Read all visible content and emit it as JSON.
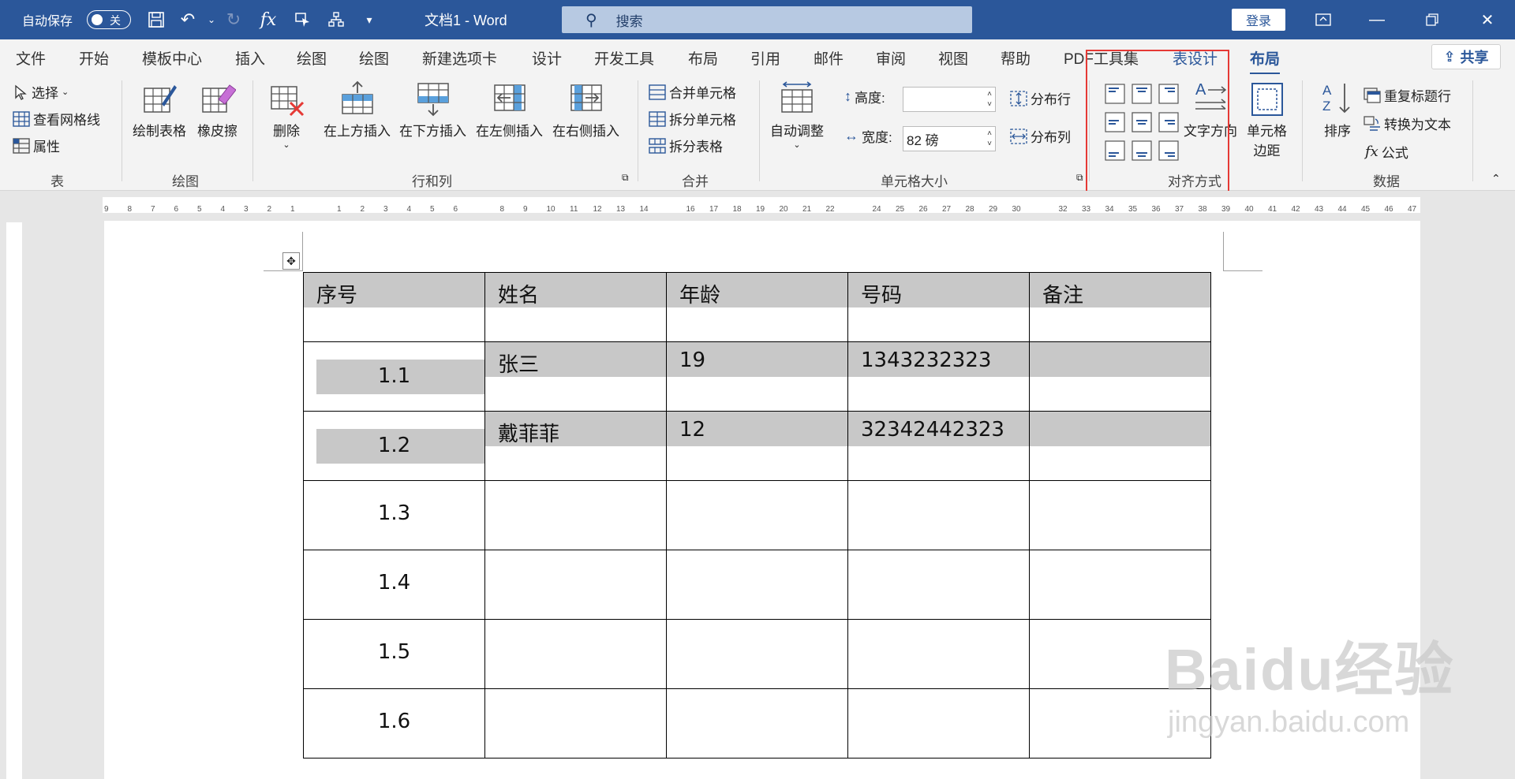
{
  "titlebar": {
    "autosave_label": "自动保存",
    "autosave_state": "关",
    "doc_title": "文档1  -  Word",
    "search_placeholder": "搜索",
    "login": "登录"
  },
  "tabs": [
    "文件",
    "开始",
    "模板中心",
    "插入",
    "绘图",
    "绘图",
    "新建选项卡",
    "设计",
    "开发工具",
    "布局",
    "引用",
    "邮件",
    "审阅",
    "视图",
    "帮助",
    "PDF工具集",
    "表设计",
    "布局"
  ],
  "share_label": "共享",
  "ribbon": {
    "table_group": {
      "select": "选择",
      "gridlines": "查看网格线",
      "properties": "属性",
      "label": "表"
    },
    "draw_group": {
      "draw_table": "绘制表格",
      "eraser": "橡皮擦",
      "label": "绘图"
    },
    "rowscols_group": {
      "delete": "删除",
      "insert_above": "在上方插入",
      "insert_below": "在下方插入",
      "insert_left": "在左侧插入",
      "insert_right": "在右侧插入",
      "label": "行和列"
    },
    "merge_group": {
      "merge_cells": "合并单元格",
      "split_cells": "拆分单元格",
      "split_table": "拆分表格",
      "label": "合并"
    },
    "cellsize_group": {
      "autofit": "自动调整",
      "height_label": "高度:",
      "height_value": "",
      "width_label": "宽度:",
      "width_value": "82 磅",
      "distribute_rows": "分布行",
      "distribute_cols": "分布列",
      "label": "单元格大小"
    },
    "alignment_group": {
      "text_direction": "文字方向",
      "cell_margins_1": "单元格",
      "cell_margins_2": "边距",
      "label": "对齐方式"
    },
    "data_group": {
      "sort": "排序",
      "repeat_header": "重复标题行",
      "convert_text": "转换为文本",
      "formula": "公式",
      "label": "数据"
    }
  },
  "ruler_numbers": [
    "9",
    "8",
    "7",
    "6",
    "5",
    "4",
    "3",
    "2",
    "1",
    "",
    "1",
    "2",
    "3",
    "4",
    "5",
    "6",
    "",
    "8",
    "9",
    "10",
    "11",
    "12",
    "13",
    "14",
    "",
    "16",
    "17",
    "18",
    "19",
    "20",
    "21",
    "22",
    "",
    "24",
    "25",
    "26",
    "27",
    "28",
    "29",
    "30",
    "",
    "32",
    "33",
    "34",
    "35",
    "36",
    "37",
    "38",
    "39",
    "40",
    "41",
    "42",
    "43",
    "44",
    "45",
    "46",
    "47"
  ],
  "table": {
    "headers": [
      "序号",
      "姓名",
      "年龄",
      "号码",
      "备注"
    ],
    "rows": [
      [
        "1.1",
        "张三",
        "19",
        "1343232323",
        ""
      ],
      [
        "1.2",
        "戴菲菲",
        "12",
        "32342442323",
        ""
      ],
      [
        "1.3",
        "",
        "",
        "",
        ""
      ],
      [
        "1.4",
        "",
        "",
        "",
        ""
      ],
      [
        "1.5",
        "",
        "",
        "",
        ""
      ],
      [
        "1.6",
        "",
        "",
        "",
        ""
      ]
    ]
  },
  "watermark": {
    "brand": "Baidu经验",
    "url": "jingyan.baidu.com"
  }
}
